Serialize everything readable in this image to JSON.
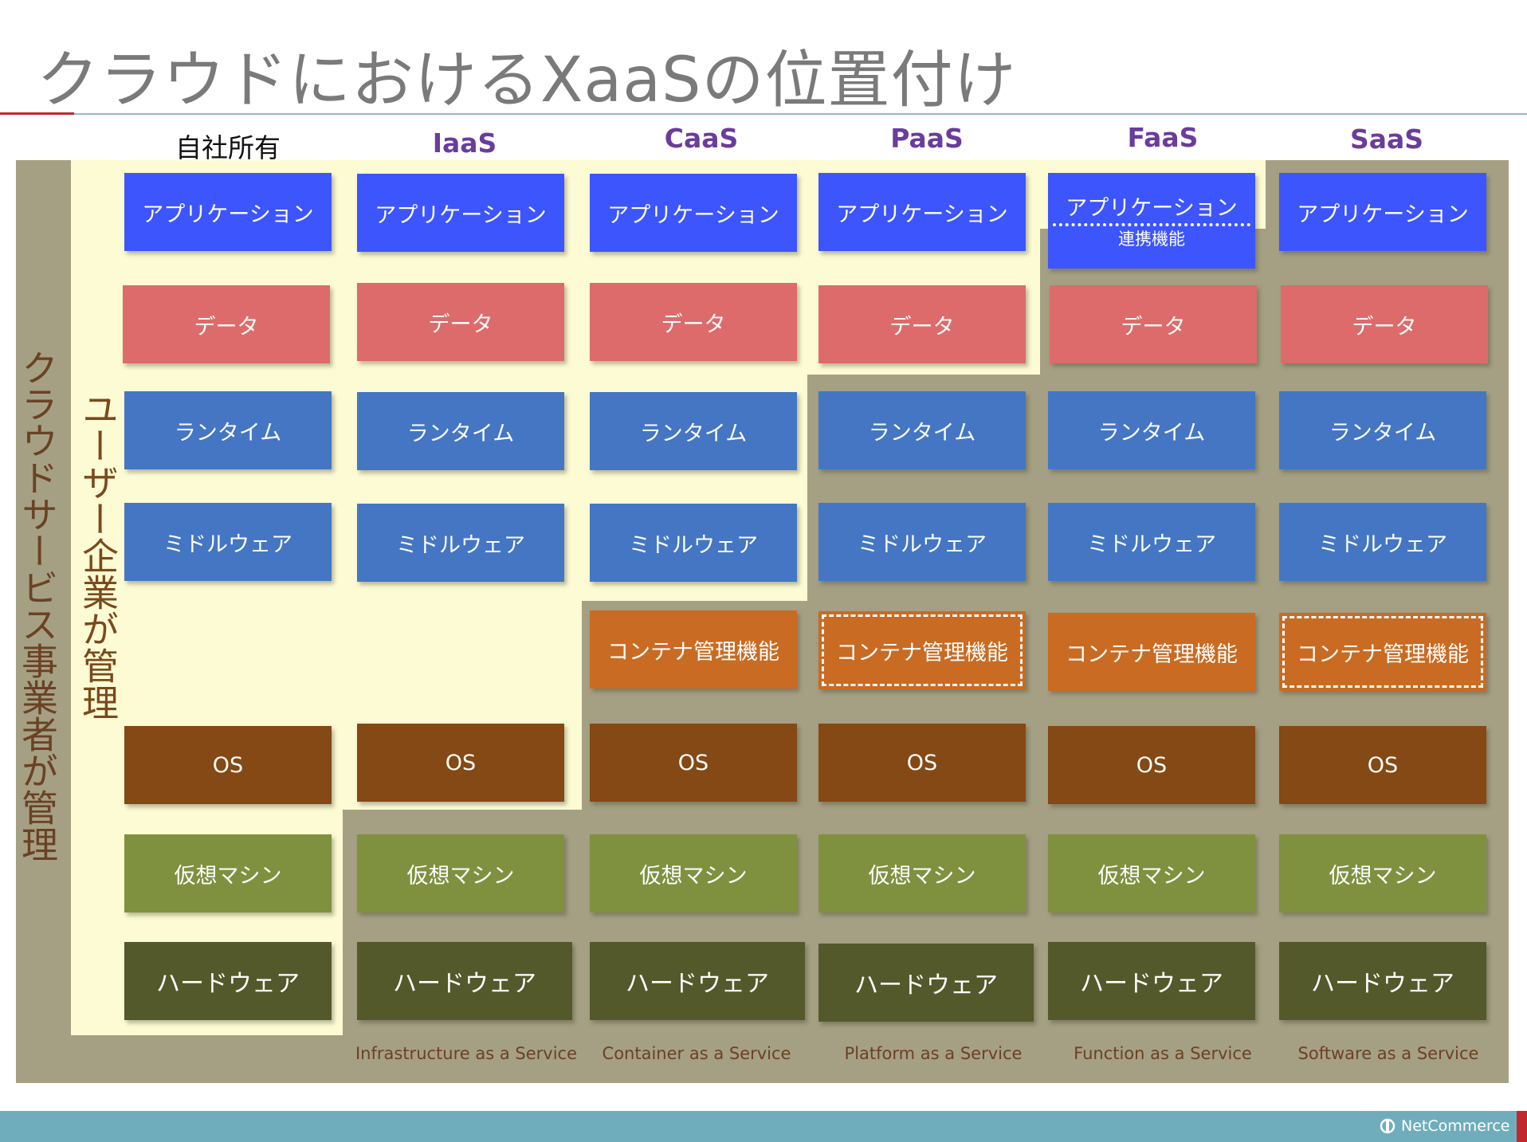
{
  "title": "クラウドにおけるXaaSの位置付け",
  "labels": {
    "provider_managed": "クラウドサービス事業者が管理",
    "user_managed": "ユーザー企業が管理"
  },
  "columns": [
    {
      "head": "自社所有",
      "foot": ""
    },
    {
      "head": "IaaS",
      "foot": "Infrastructure as a Service"
    },
    {
      "head": "CaaS",
      "foot": "Container as a Service"
    },
    {
      "head": "PaaS",
      "foot": "Platform as a Service"
    },
    {
      "head": "FaaS",
      "foot": "Function as a Service"
    },
    {
      "head": "SaaS",
      "foot": "Software as a Service"
    }
  ],
  "layers": {
    "app": "アプリケーション",
    "faas_sub": "連携機能",
    "data": "データ",
    "runtime": "ランタイム",
    "middleware": "ミドルウェア",
    "container": "コンテナ管理機能",
    "os": "OS",
    "vm": "仮想マシン",
    "hw": "ハードウェア"
  },
  "footer": {
    "logo": "NetCommerce"
  },
  "colors": {
    "app": "#3d55fd",
    "data": "#dd6b6b",
    "runtime": "#4476c4",
    "container": "#c96b22",
    "os": "#844914",
    "vm": "#7f913f",
    "hw": "#54592b",
    "provider_bg": "#a5a083",
    "user_bg": "#fdfbd4",
    "heading": "#6a3c9c"
  }
}
